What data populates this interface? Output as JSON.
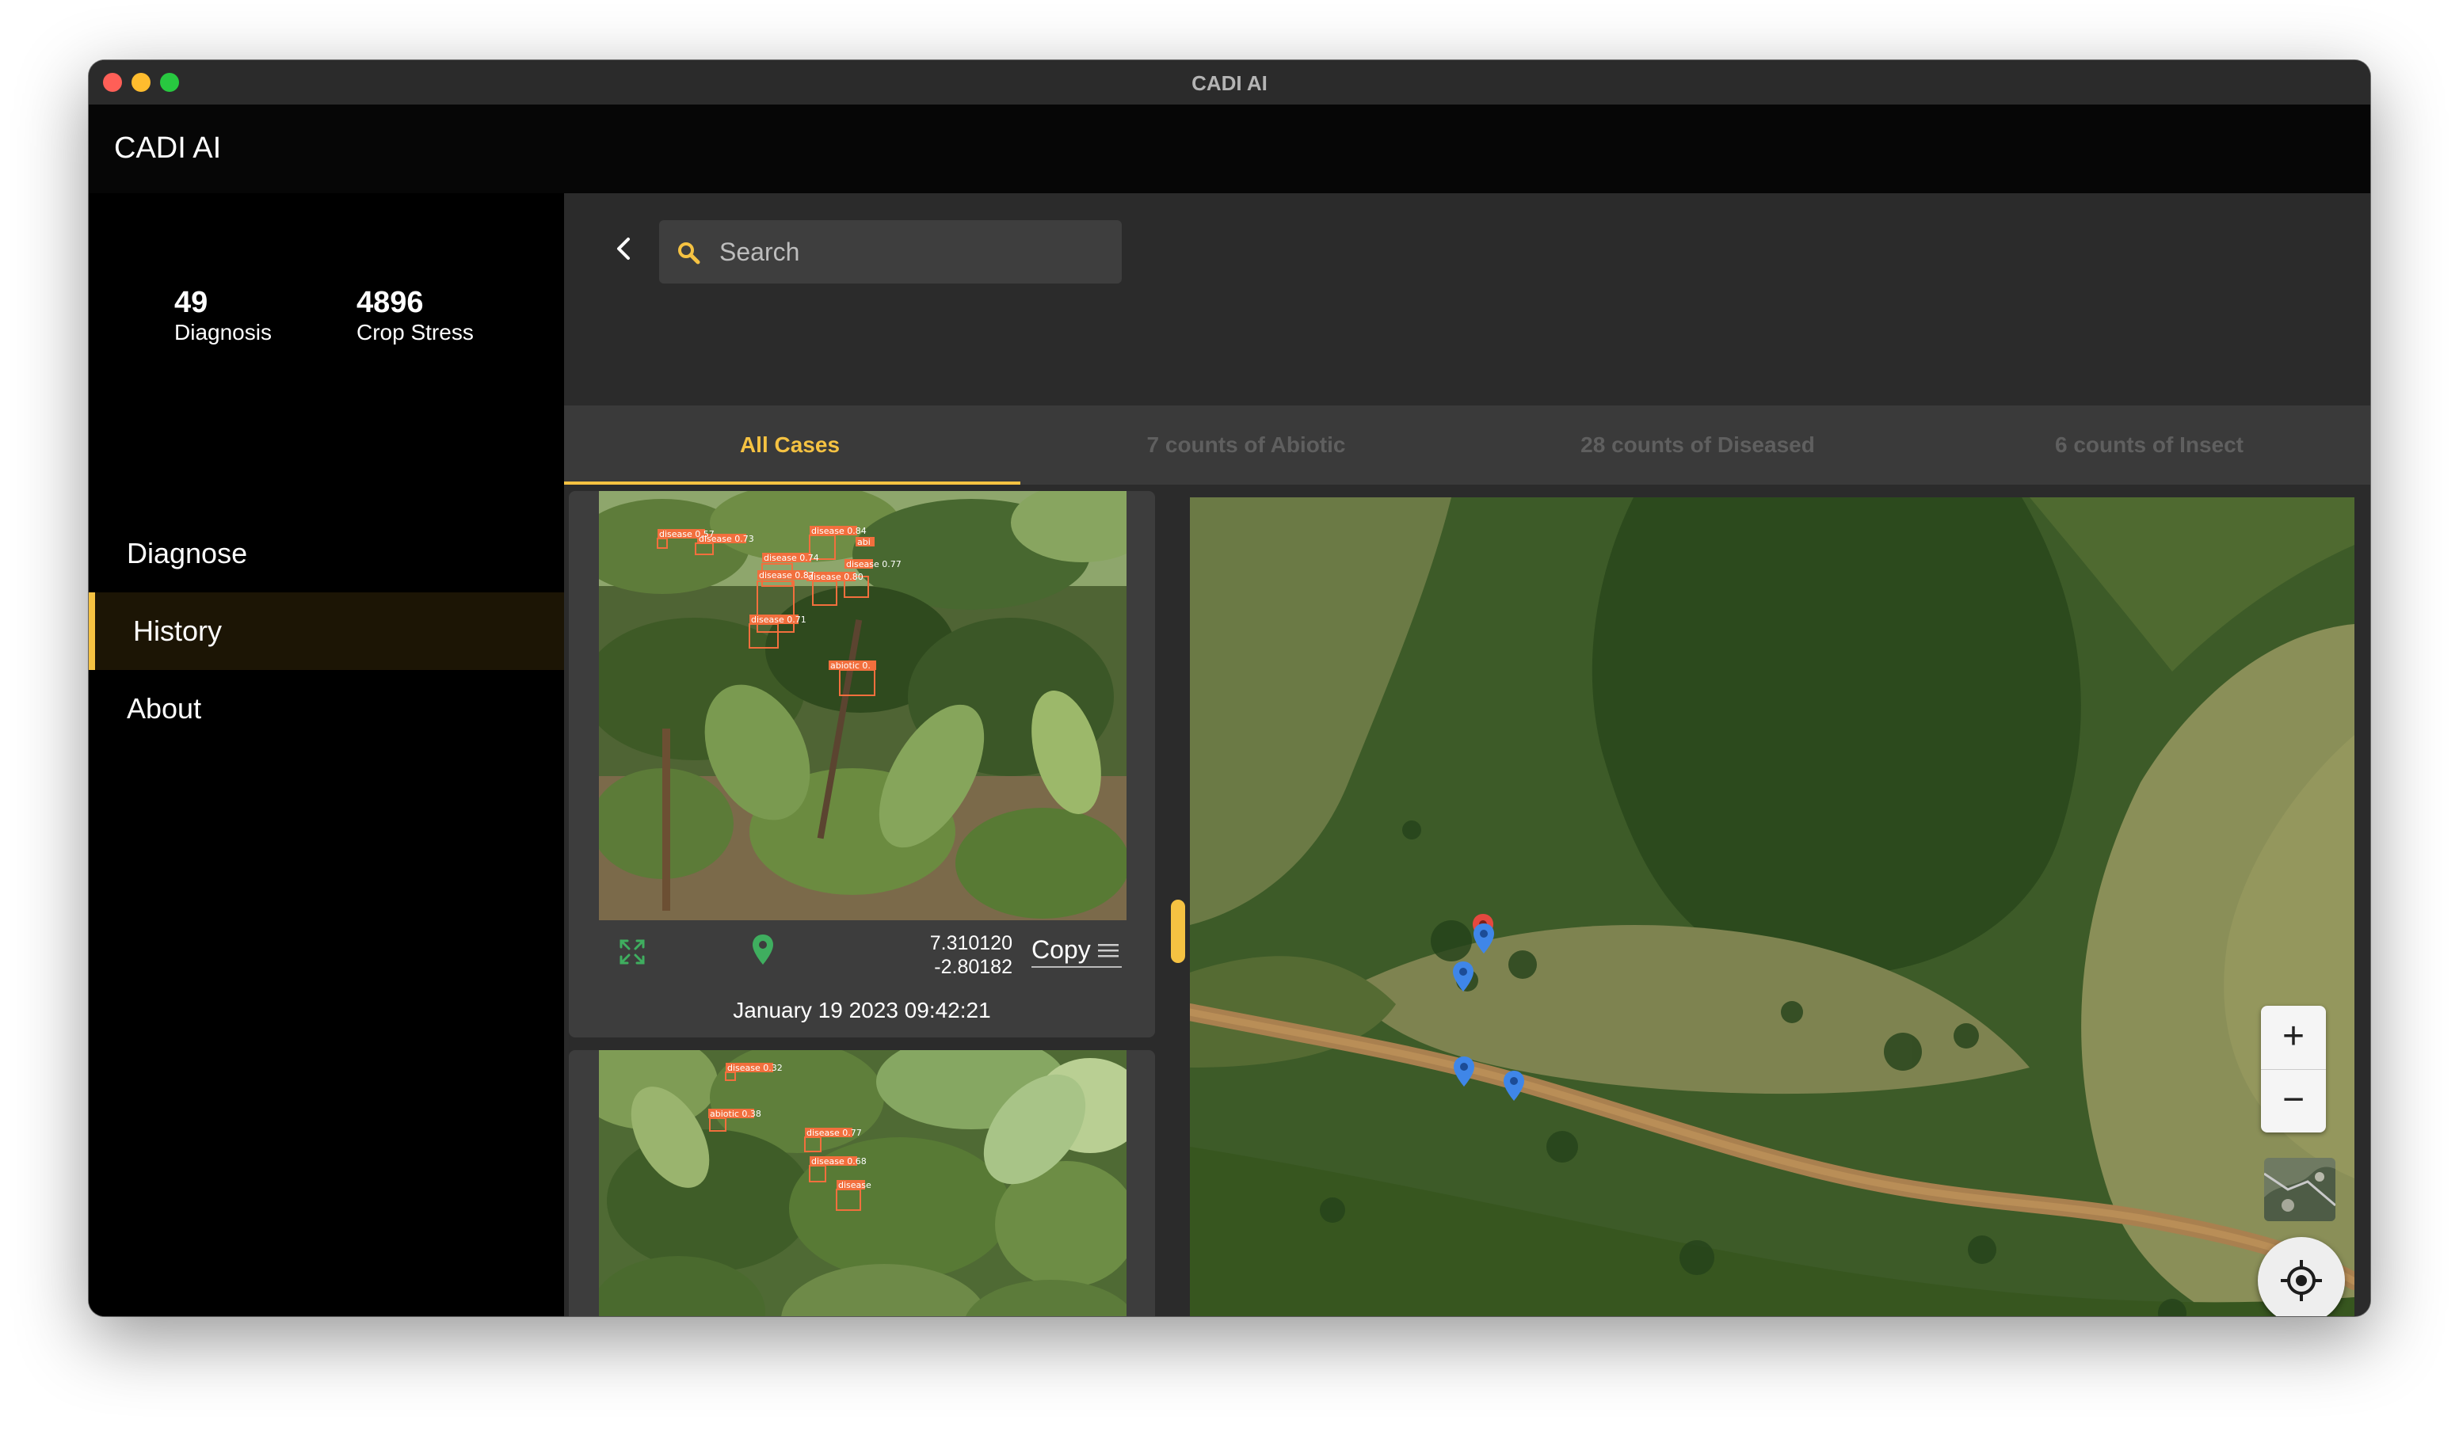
{
  "window": {
    "title": "CADI AI"
  },
  "app": {
    "title": "CADI AI"
  },
  "stats": [
    {
      "value": "49",
      "label": "Diagnosis"
    },
    {
      "value": "4896",
      "label": "Crop Stress"
    }
  ],
  "nav": [
    {
      "label": "Diagnose",
      "active": false
    },
    {
      "label": "History",
      "active": true
    },
    {
      "label": "About",
      "active": false
    }
  ],
  "search": {
    "placeholder": "Search",
    "value": ""
  },
  "tabs": [
    {
      "label": "All Cases",
      "active": true
    },
    {
      "label": "7 counts of Abiotic",
      "active": false
    },
    {
      "label": "28 counts of Diseased",
      "active": false
    },
    {
      "label": "6 counts of Insect",
      "active": false
    }
  ],
  "cases": [
    {
      "latitude": "7.310120",
      "longitude": "-2.80182",
      "copy_label": "Copy",
      "date": "January 19 2023 09:42:21",
      "detections": [
        "disease 0.57",
        "disease 0.73",
        "disease 0.84",
        "disease 0.74",
        "disease 0.87",
        "disease 0.80",
        "disease 0.77",
        "disease 0.71",
        "abiotic 0.",
        "abi",
        "abiotic"
      ]
    },
    {
      "detections": [
        "disease 0.32",
        "abiotic 0.38",
        "disease 0.77",
        "disease 0.68",
        "disease"
      ]
    }
  ],
  "map": {
    "zoom_in_label": "+",
    "zoom_out_label": "−",
    "marker_colors": {
      "selected": "#e5483f",
      "default": "#3f86e8"
    }
  },
  "colors": {
    "accent": "#f5c242",
    "background": "#000000",
    "panel": "#2b2b2b",
    "card": "#3d3d3d",
    "detection_box": "#f26f3d"
  },
  "icons": {
    "back": "chevron-left-icon",
    "search": "search-icon",
    "expand": "expand-icon",
    "location": "location-pin-icon",
    "menu": "menu-icon",
    "locate": "my-location-icon"
  }
}
